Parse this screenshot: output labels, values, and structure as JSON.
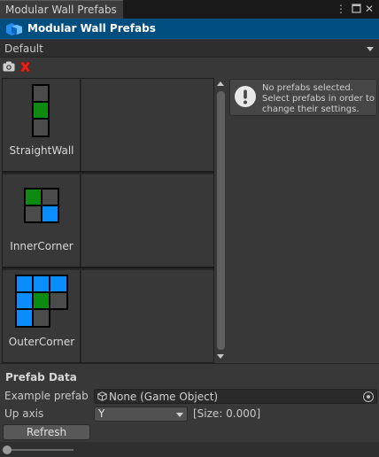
{
  "tab": {
    "title": "Modular Wall Prefabs",
    "menu_icon": "kebab-menu-icon",
    "maximize_icon": "maximize-icon",
    "close_icon": "close-icon"
  },
  "window": {
    "title": "Modular Wall Prefabs",
    "icon": "prefab-cube-icon"
  },
  "palette": {
    "selected": "Default"
  },
  "toolbar": {
    "screenshot_icon": "camera-icon",
    "remove_icon": "red-x-icon"
  },
  "prefabs": [
    {
      "name": "StraightWall"
    },
    {
      "name": "InnerCorner"
    },
    {
      "name": "OuterCorner"
    }
  ],
  "info": {
    "icon": "warning-icon",
    "message": "No prefabs selected. Select prefabs in order to change their settings."
  },
  "prefab_data": {
    "title": "Prefab Data",
    "example_prefab_label": "Example prefab",
    "example_prefab_value": "None (Game Object)",
    "up_axis_label": "Up axis",
    "up_axis_value": "Y",
    "size_text": "[Size: 0.000]",
    "refresh_label": "Refresh"
  },
  "colors": {
    "accent": "#004d80",
    "green": "#0d8a12",
    "blue": "#0a8dff",
    "dark_tile": "#4b4b4b"
  }
}
